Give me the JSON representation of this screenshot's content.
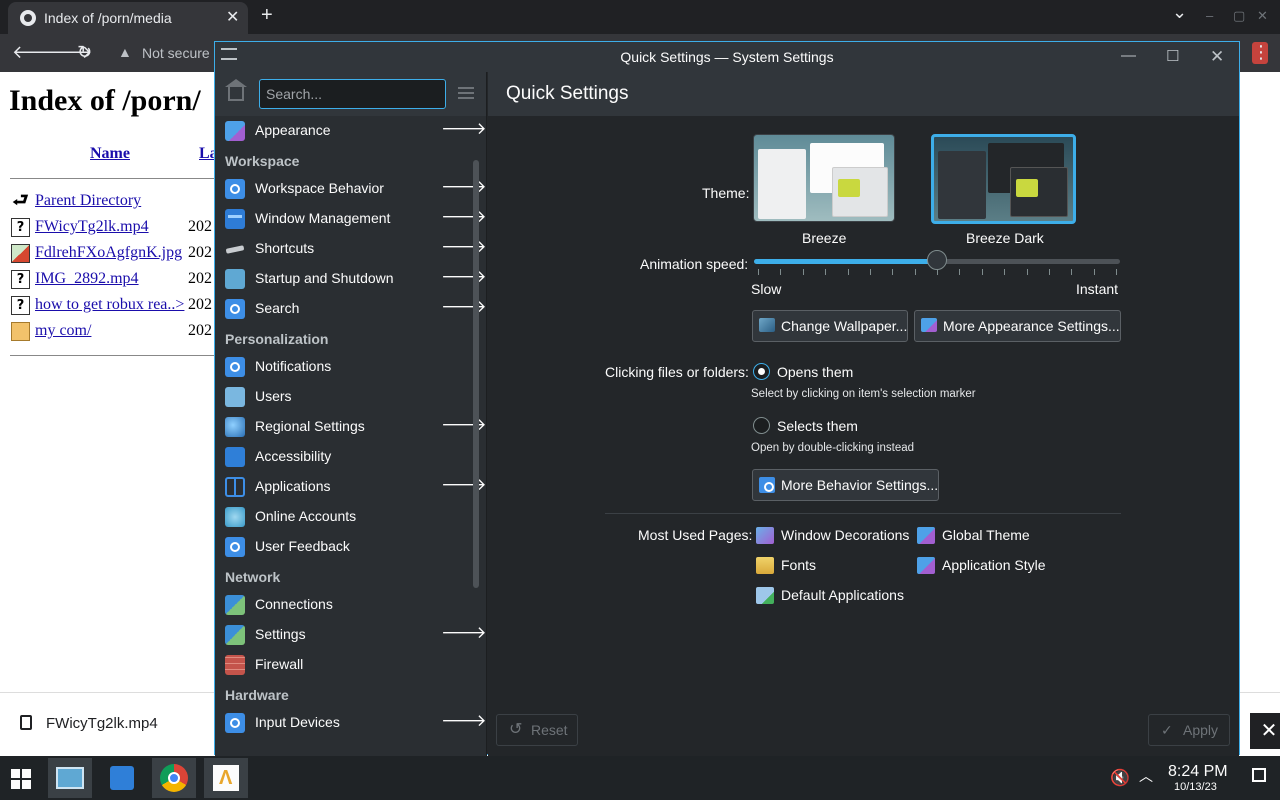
{
  "browser": {
    "tab_title": "Index of /porn/media",
    "new_tab": "+",
    "close_tab": "✕",
    "omnibox_security": "Not secure",
    "chevron": "⌄",
    "win_min": "–",
    "win_restore": "▢",
    "win_close": "✕",
    "menu": "⋮"
  },
  "webpage": {
    "heading": "Index of /porn/",
    "col_name": "Name",
    "col_last": "La",
    "rows": [
      {
        "icon": "back-icon",
        "name": "Parent Directory",
        "date": ""
      },
      {
        "icon": "unknown-file-icon",
        "name": "FWicyTg2lk.mp4",
        "date": "202"
      },
      {
        "icon": "image-file-icon",
        "name": "FdlrehFXoAgfgnK.jpg",
        "date": "202"
      },
      {
        "icon": "unknown-file-icon",
        "name": "IMG_2892.mp4",
        "date": "202"
      },
      {
        "icon": "unknown-file-icon",
        "name": "how to get robux rea..>",
        "date": "202"
      },
      {
        "icon": "folder-icon",
        "name": "my com/",
        "date": "202"
      }
    ]
  },
  "download_bar": {
    "file": "FWicyTg2lk.mp4",
    "close": "✕"
  },
  "settings_window": {
    "title": "Quick Settings — System Settings",
    "search_placeholder": "Search...",
    "page_title": "Quick Settings",
    "accent": "#3daee9",
    "sidebar": {
      "top_items": [
        {
          "label": "Appearance",
          "icon": "appearance-icon",
          "arrow": "🡒"
        }
      ],
      "categories": [
        {
          "label": "Workspace",
          "items": [
            {
              "label": "Workspace Behavior",
              "icon": "gear-icon",
              "arrow": "🡒"
            },
            {
              "label": "Window Management",
              "icon": "window-icon",
              "arrow": "🡒"
            },
            {
              "label": "Shortcuts",
              "icon": "shortcut-icon",
              "arrow": "🡒"
            },
            {
              "label": "Startup and Shutdown",
              "icon": "startup-icon",
              "arrow": "🡒"
            },
            {
              "label": "Search",
              "icon": "gear-icon",
              "arrow": "🡒"
            }
          ]
        },
        {
          "label": "Personalization",
          "items": [
            {
              "label": "Notifications",
              "icon": "gear-icon",
              "arrow": ""
            },
            {
              "label": "Users",
              "icon": "users-icon",
              "arrow": ""
            },
            {
              "label": "Regional Settings",
              "icon": "globe-icon",
              "arrow": "🡒"
            },
            {
              "label": "Accessibility",
              "icon": "accessibility-icon",
              "arrow": ""
            },
            {
              "label": "Applications",
              "icon": "applications-icon",
              "arrow": "🡒"
            },
            {
              "label": "Online Accounts",
              "icon": "online-accounts-icon",
              "arrow": ""
            },
            {
              "label": "User Feedback",
              "icon": "gear-icon",
              "arrow": ""
            }
          ]
        },
        {
          "label": "Network",
          "items": [
            {
              "label": "Connections",
              "icon": "network-icon",
              "arrow": ""
            },
            {
              "label": "Settings",
              "icon": "network-icon",
              "arrow": "🡒"
            },
            {
              "label": "Firewall",
              "icon": "firewall-icon",
              "arrow": ""
            }
          ]
        },
        {
          "label": "Hardware",
          "items": [
            {
              "label": "Input Devices",
              "icon": "gear-icon",
              "arrow": "🡒"
            }
          ]
        }
      ]
    },
    "theme": {
      "label": "Theme:",
      "options": [
        {
          "name": "Breeze",
          "selected": false
        },
        {
          "name": "Breeze Dark",
          "selected": true
        }
      ]
    },
    "animation": {
      "label": "Animation speed:",
      "min_label": "Slow",
      "max_label": "Instant",
      "value_fraction": 0.5
    },
    "buttons": {
      "change_wallpaper": "Change Wallpaper...",
      "more_appearance": "More Appearance Settings...",
      "more_behavior": "More Behavior Settings...",
      "reset": "Reset",
      "apply": "Apply"
    },
    "clicking": {
      "label": "Clicking files or folders:",
      "opens": "Opens them",
      "opens_hint": "Select by clicking on item's selection marker",
      "selects": "Selects them",
      "selects_hint": "Open by double-clicking instead",
      "selected": "opens"
    },
    "most_used": {
      "label": "Most Used Pages:",
      "items": [
        "Window Decorations",
        "Global Theme",
        "Fonts",
        "Application Style",
        "Default Applications"
      ]
    }
  },
  "taskbar": {
    "time": "8:24 PM",
    "date": "10/13/23"
  }
}
